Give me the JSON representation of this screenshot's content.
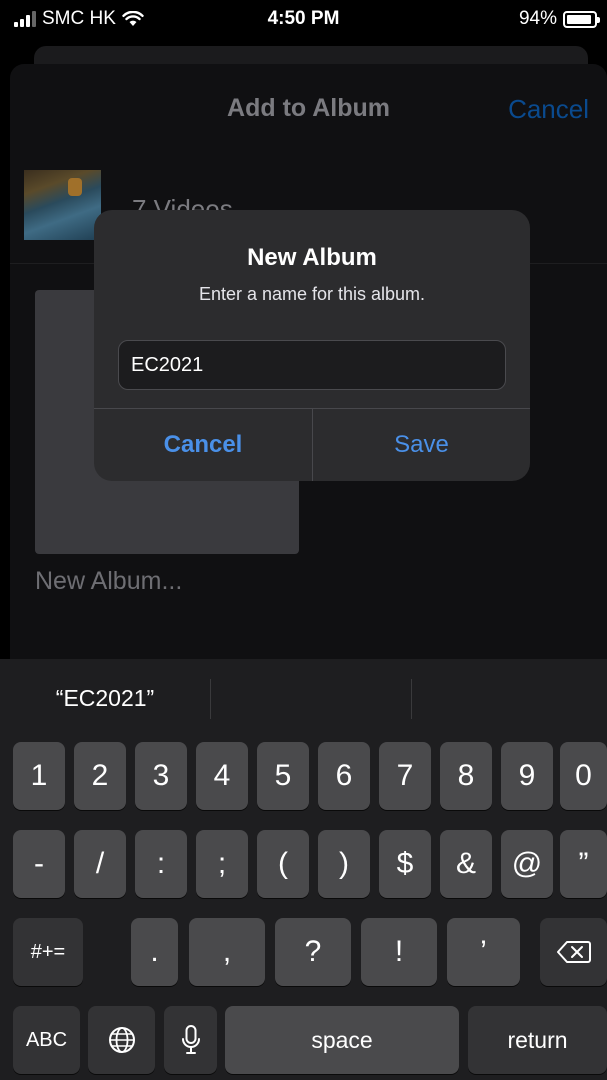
{
  "status_bar": {
    "carrier": "SMC HK",
    "time": "4:50 PM",
    "battery": "94%",
    "battery_level": 0.94
  },
  "sheet": {
    "title": "Add to Album",
    "cancel_label": "Cancel",
    "item_label": "7 Videos",
    "new_album_label": "New Album..."
  },
  "dialog": {
    "title": "New Album",
    "message": "Enter a name for this album.",
    "input_value": "EC2021",
    "cancel_label": "Cancel",
    "save_label": "Save"
  },
  "keyboard": {
    "suggestions": [
      "“EC2021”",
      "",
      ""
    ],
    "row1": [
      "1",
      "2",
      "3",
      "4",
      "5",
      "6",
      "7",
      "8",
      "9",
      "0"
    ],
    "row2": [
      "-",
      "/",
      ":",
      ";",
      "(",
      ")",
      "$",
      "&",
      "@",
      "”"
    ],
    "row3_mode": "#+=",
    "row3": [
      ".",
      ",",
      "?",
      "!",
      "’"
    ],
    "abc_label": "ABC",
    "space_label": "space",
    "return_label": "return"
  },
  "colors": {
    "accent": "#4a90e8",
    "dialog_bg": "#2c2c2e",
    "key_bg": "#4a4a4c",
    "keyboard_bg": "#1e1e20"
  }
}
